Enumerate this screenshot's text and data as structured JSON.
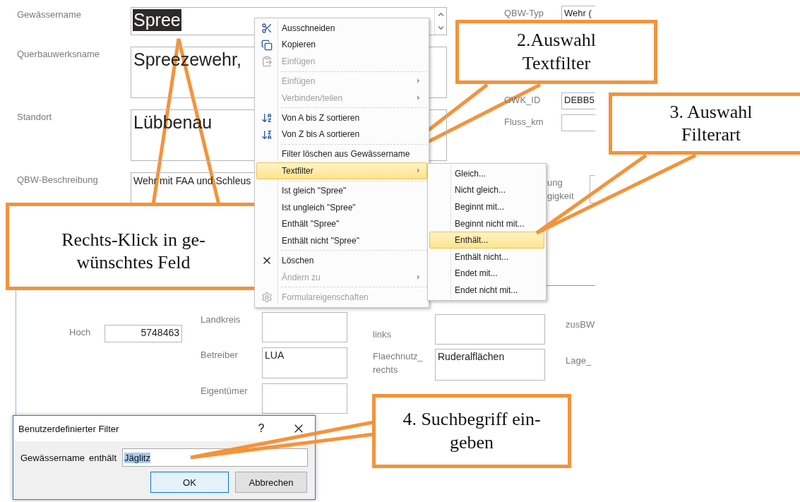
{
  "form": {
    "main_fields": [
      {
        "label": "Gewässername",
        "value": "Spree",
        "kind": "scrolling",
        "highlighted": true
      },
      {
        "label": "Querbauwerksname",
        "value": "Spreezewehr,",
        "kind": "large",
        "highlighted": false
      },
      {
        "label": "Standort",
        "value": "Lübbenau",
        "kind": "large",
        "highlighted": false
      },
      {
        "label": "QBW-Beschreibung",
        "value": "Wehr mit FAA und Schleus",
        "kind": "memo",
        "highlighted": false
      }
    ],
    "side_fields": [
      {
        "label": "QBW-Typ",
        "value": "Wehr ("
      },
      {
        "label": "OWK_ID",
        "value": "DEBB5"
      },
      {
        "label": "Fluss_km"
      },
      {
        "label": "ung\ngigkeit"
      }
    ],
    "detail_columns": [
      {
        "fields": [
          {
            "label": "Hoch",
            "value": "5748463"
          }
        ]
      },
      {
        "fields": [
          {
            "label": "Landkreis"
          },
          {
            "label": "Betreiber",
            "value": "LUA"
          },
          {
            "label": "Eigentümer"
          }
        ]
      },
      {
        "fields": [
          {
            "label": "links"
          },
          {
            "label": "Flaechnutz_\nrechts",
            "value": "Ruderalflächen"
          }
        ]
      },
      {
        "fields": [
          {
            "label": "zusBW"
          },
          {
            "label": "Lage_"
          }
        ]
      }
    ]
  },
  "context_menu": {
    "items": [
      {
        "kind": "item",
        "label": "Ausschneiden",
        "disabled": false,
        "submenu": false,
        "selected": false
      },
      {
        "kind": "item",
        "label": "Kopieren",
        "disabled": false,
        "submenu": false,
        "selected": false
      },
      {
        "kind": "item",
        "label": "Einfügen",
        "disabled": true,
        "submenu": false,
        "selected": false
      },
      {
        "kind": "separator"
      },
      {
        "kind": "item",
        "label": "Einfügen",
        "disabled": true,
        "submenu": true,
        "selected": false
      },
      {
        "kind": "item",
        "label": "Verbinden/teilen",
        "disabled": true,
        "submenu": true,
        "selected": false
      },
      {
        "kind": "separator"
      },
      {
        "kind": "item",
        "label": "Von A bis Z sortieren",
        "disabled": false,
        "submenu": false,
        "selected": false
      },
      {
        "kind": "item",
        "label": "Von Z bis A sortieren",
        "disabled": false,
        "submenu": false,
        "selected": false
      },
      {
        "kind": "separator"
      },
      {
        "kind": "item",
        "label": "Filter löschen aus Gewässername",
        "disabled": false,
        "submenu": false,
        "selected": false
      },
      {
        "kind": "item",
        "label": "Textfilter",
        "disabled": false,
        "submenu": true,
        "selected": true
      },
      {
        "kind": "separator"
      },
      {
        "kind": "item",
        "label": "Ist gleich \"Spree\"",
        "disabled": false,
        "submenu": false,
        "selected": false
      },
      {
        "kind": "item",
        "label": "Ist ungleich \"Spree\"",
        "disabled": false,
        "submenu": false,
        "selected": false
      },
      {
        "kind": "item",
        "label": "Enthält \"Spree\"",
        "disabled": false,
        "submenu": false,
        "selected": false
      },
      {
        "kind": "item",
        "label": "Enthält nicht \"Spree\"",
        "disabled": false,
        "submenu": false,
        "selected": false
      },
      {
        "kind": "separator"
      },
      {
        "kind": "item",
        "label": "Löschen",
        "disabled": false,
        "submenu": false,
        "selected": false
      },
      {
        "kind": "item",
        "label": "Ändern zu",
        "disabled": true,
        "submenu": true,
        "selected": false
      },
      {
        "kind": "separator"
      },
      {
        "kind": "item",
        "label": "Formulareigenschaften",
        "disabled": true,
        "submenu": false,
        "selected": false
      }
    ]
  },
  "submenu": {
    "items": [
      {
        "label": "Gleich...",
        "selected": false
      },
      {
        "label": "Nicht gleich...",
        "selected": false
      },
      {
        "label": "Beginnt mit...",
        "selected": false
      },
      {
        "label": "Beginnt nicht mit...",
        "selected": false
      },
      {
        "label": "Enthält...",
        "selected": true
      },
      {
        "label": "Enthält nicht...",
        "selected": false
      },
      {
        "label": "Endet mit...",
        "selected": false
      },
      {
        "label": "Endet nicht mit...",
        "selected": false
      }
    ]
  },
  "dialog": {
    "title": "Benutzerdefinierter Filter",
    "help": "?",
    "field_label": "Gewässername",
    "operator": "enthält",
    "value": "Jäglitz",
    "value_selected": true,
    "buttons": [
      {
        "label": "OK",
        "default": true
      },
      {
        "label": "Abbrechen",
        "default": false
      }
    ]
  },
  "callouts": [
    {
      "text": "Rechts-Klick in ge-\nwünschtes Feld"
    },
    {
      "text": "2.Auswahl\nTextfilter"
    },
    {
      "text": "3. Auswahl\nFilterart"
    },
    {
      "text": "4. Suchbegriff ein-\ngeben"
    }
  ]
}
